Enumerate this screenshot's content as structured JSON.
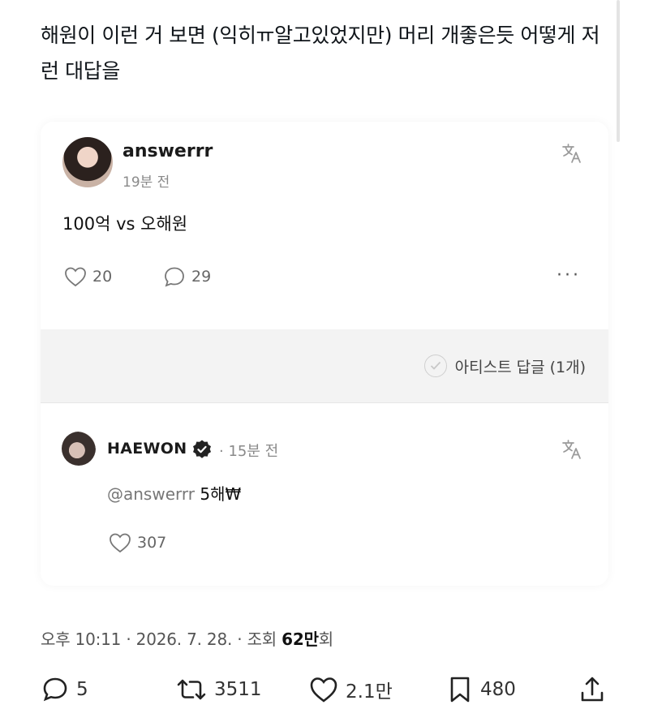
{
  "post": {
    "text": "해원이 이런 거 보면 (익히ㅠ알고있었지만) 머리 개좋은듯 어떻게 저런 대답을"
  },
  "quote": {
    "author": "answerrr",
    "time": "19분 전",
    "body": "100억 vs 오해원",
    "likes": "20",
    "replies": "29",
    "more_label": "···",
    "artist_reply_label": "아티스트 답글 (1개)",
    "reply": {
      "author": "HAEWON",
      "time": "· 15분 전",
      "mention": "@answerrr",
      "text": "5해₩",
      "likes": "307"
    }
  },
  "meta": {
    "prefix": "오후 10:11 · 2026. 7. 28. · 조회 ",
    "views_bold": "62만",
    "suffix": "회"
  },
  "actions": {
    "replies": "5",
    "retweets": "3511",
    "likes": "2.1만",
    "bookmarks": "480"
  },
  "colors": {
    "text": "#0f1419",
    "secondary": "#8a8a8a",
    "band": "#f3f3f3"
  }
}
